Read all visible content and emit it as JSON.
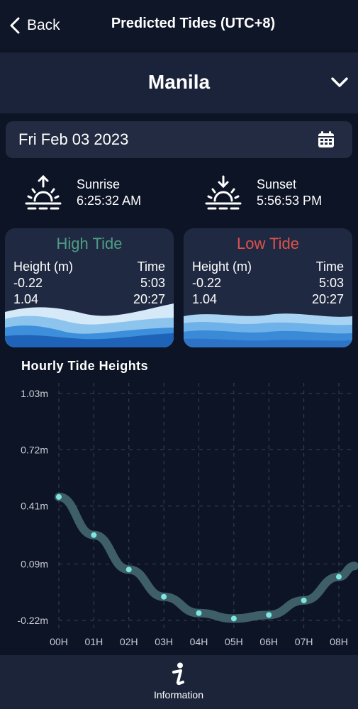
{
  "header": {
    "back_label": "Back",
    "title": "Predicted Tides (UTC+8)"
  },
  "location": {
    "name": "Manila"
  },
  "date": {
    "value": "Fri Feb 03 2023"
  },
  "sunrise": {
    "label": "Sunrise",
    "time": "6:25:32 AM"
  },
  "sunset": {
    "label": "Sunset",
    "time": "5:56:53 PM"
  },
  "high_tide": {
    "title": "High Tide",
    "height_header": "Height (m)",
    "time_header": "Time",
    "rows": [
      {
        "height": "-0.22",
        "time": "5:03"
      },
      {
        "height": "1.04",
        "time": "20:27"
      }
    ]
  },
  "low_tide": {
    "title": "Low Tide",
    "height_header": "Height (m)",
    "time_header": "Time",
    "rows": [
      {
        "height": "-0.22",
        "time": "5:03"
      },
      {
        "height": "1.04",
        "time": "20:27"
      }
    ]
  },
  "chart_title": "Hourly Tide Heights",
  "chart_data": {
    "type": "line",
    "x": [
      "00H",
      "01H",
      "02H",
      "03H",
      "04H",
      "05H",
      "06H",
      "07H",
      "08H"
    ],
    "series": [
      {
        "values": [
          0.46,
          0.25,
          0.06,
          -0.09,
          -0.18,
          -0.21,
          -0.19,
          -0.11,
          0.02
        ]
      }
    ],
    "yticks": [
      "1.03m",
      "0.72m",
      "0.41m",
      "0.09m",
      "-0.22m"
    ],
    "ytick_values": [
      1.03,
      0.72,
      0.41,
      0.09,
      -0.22
    ],
    "ylim": [
      -0.22,
      1.03
    ],
    "grid": true
  },
  "bottom_nav": {
    "info_label": "Information"
  },
  "colors": {
    "high_title": "#4f9c84",
    "low_title": "#e0514b",
    "line": "#3e5e68",
    "point": "#7ee6e0"
  }
}
